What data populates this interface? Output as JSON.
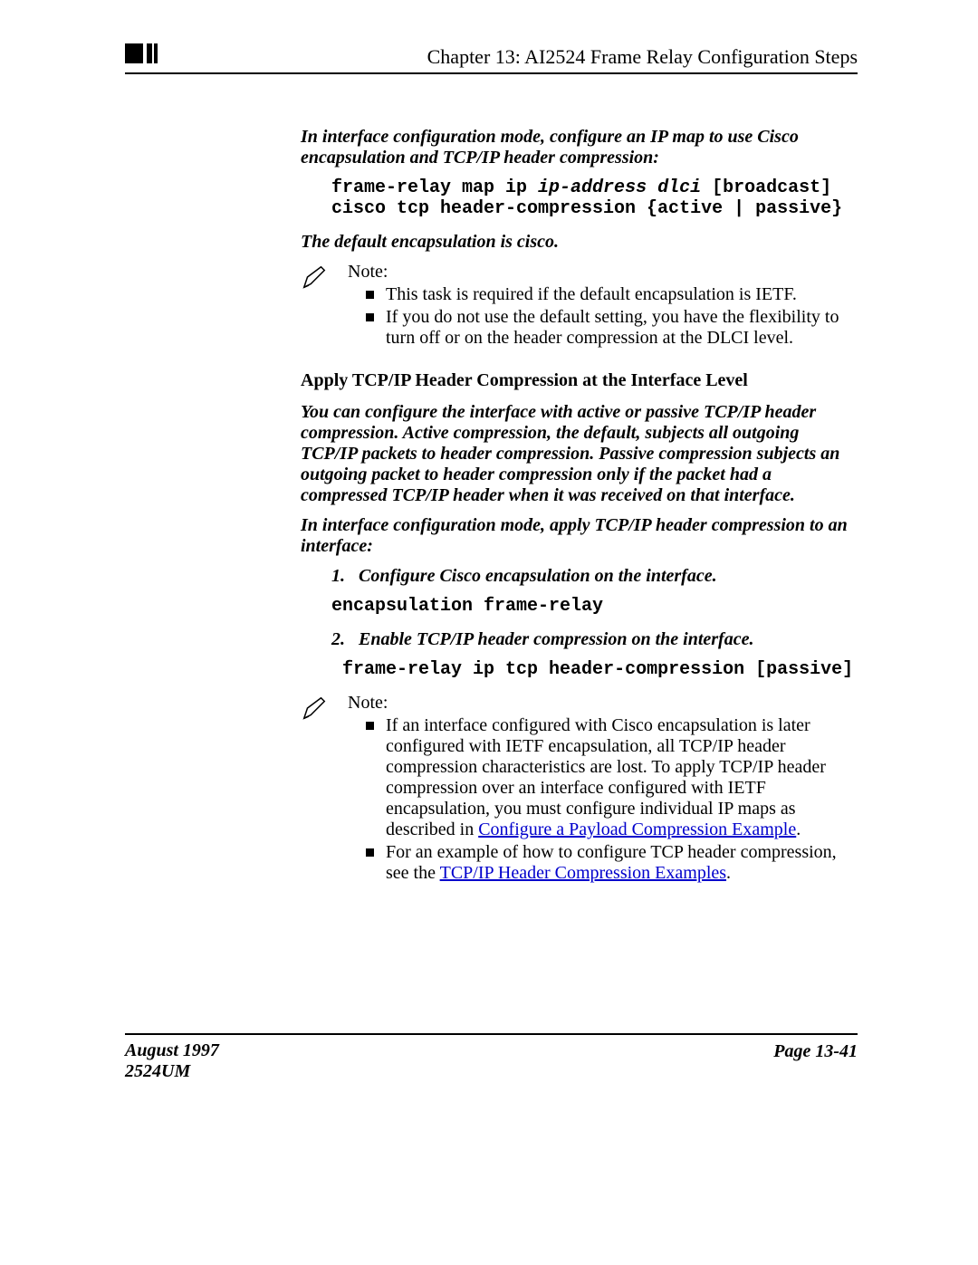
{
  "header": {
    "chapter_title": "Chapter 13: AI2524 Frame Relay Configuration Steps"
  },
  "body": {
    "p1": "In interface configuration mode, configure an IP map to use Cisco encapsulation and TCP/IP header compression:",
    "code1a": "frame-relay map ip ",
    "code1b": "ip-address dlci",
    "code1c": " [broadcast] cisco tcp header-compression {active | passive}",
    "p2": "The default encapsulation is cisco.",
    "note1": {
      "lead": "Note:",
      "bullets": [
        "This task is required if the default encapsulation is IETF.",
        "If you do not use the default setting, you have the flexibility to turn off or on the header compression at the DLCI level."
      ]
    },
    "section2_head": "Apply TCP/IP Header Compression at the Interface Level",
    "p3": "You can configure the interface with active or passive TCP/IP header compression. Active compression, the default, subjects all outgoing TCP/IP packets to header compression. Passive compression subjects an outgoing packet to header compression only if the packet had a compressed TCP/IP header when it was received on that interface.",
    "p4": "In interface configuration mode, apply TCP/IP header compression to an interface:",
    "steps": [
      {
        "num": "1.",
        "text": "Configure Cisco encapsulation on the interface.",
        "code": "encapsulation frame-relay"
      },
      {
        "num": "2.",
        "text": " Enable TCP/IP header compression on the interface.",
        "code": " frame-relay ip tcp header-compression [passive]"
      }
    ],
    "note2": {
      "lead": "Note:",
      "bullets_pre": [
        "If an interface configured with Cisco encapsulation is later configured with IETF encapsulation, all TCP/IP header compression characteristics are lost. To apply TCP/IP header compression over an interface configured with IETF encapsulation, you must configure individual IP maps as described in "
      ],
      "bullets_item2_before": "For an example of how to configure TCP header compression, see the ",
      "link1": "Configure a Payload Compression Example",
      "link2": "TCP/IP Header Compression Examples",
      "after_link2": "."
    }
  },
  "footer": {
    "date": "August 1997",
    "doc": "2524UM",
    "page": "Page 13-41"
  }
}
